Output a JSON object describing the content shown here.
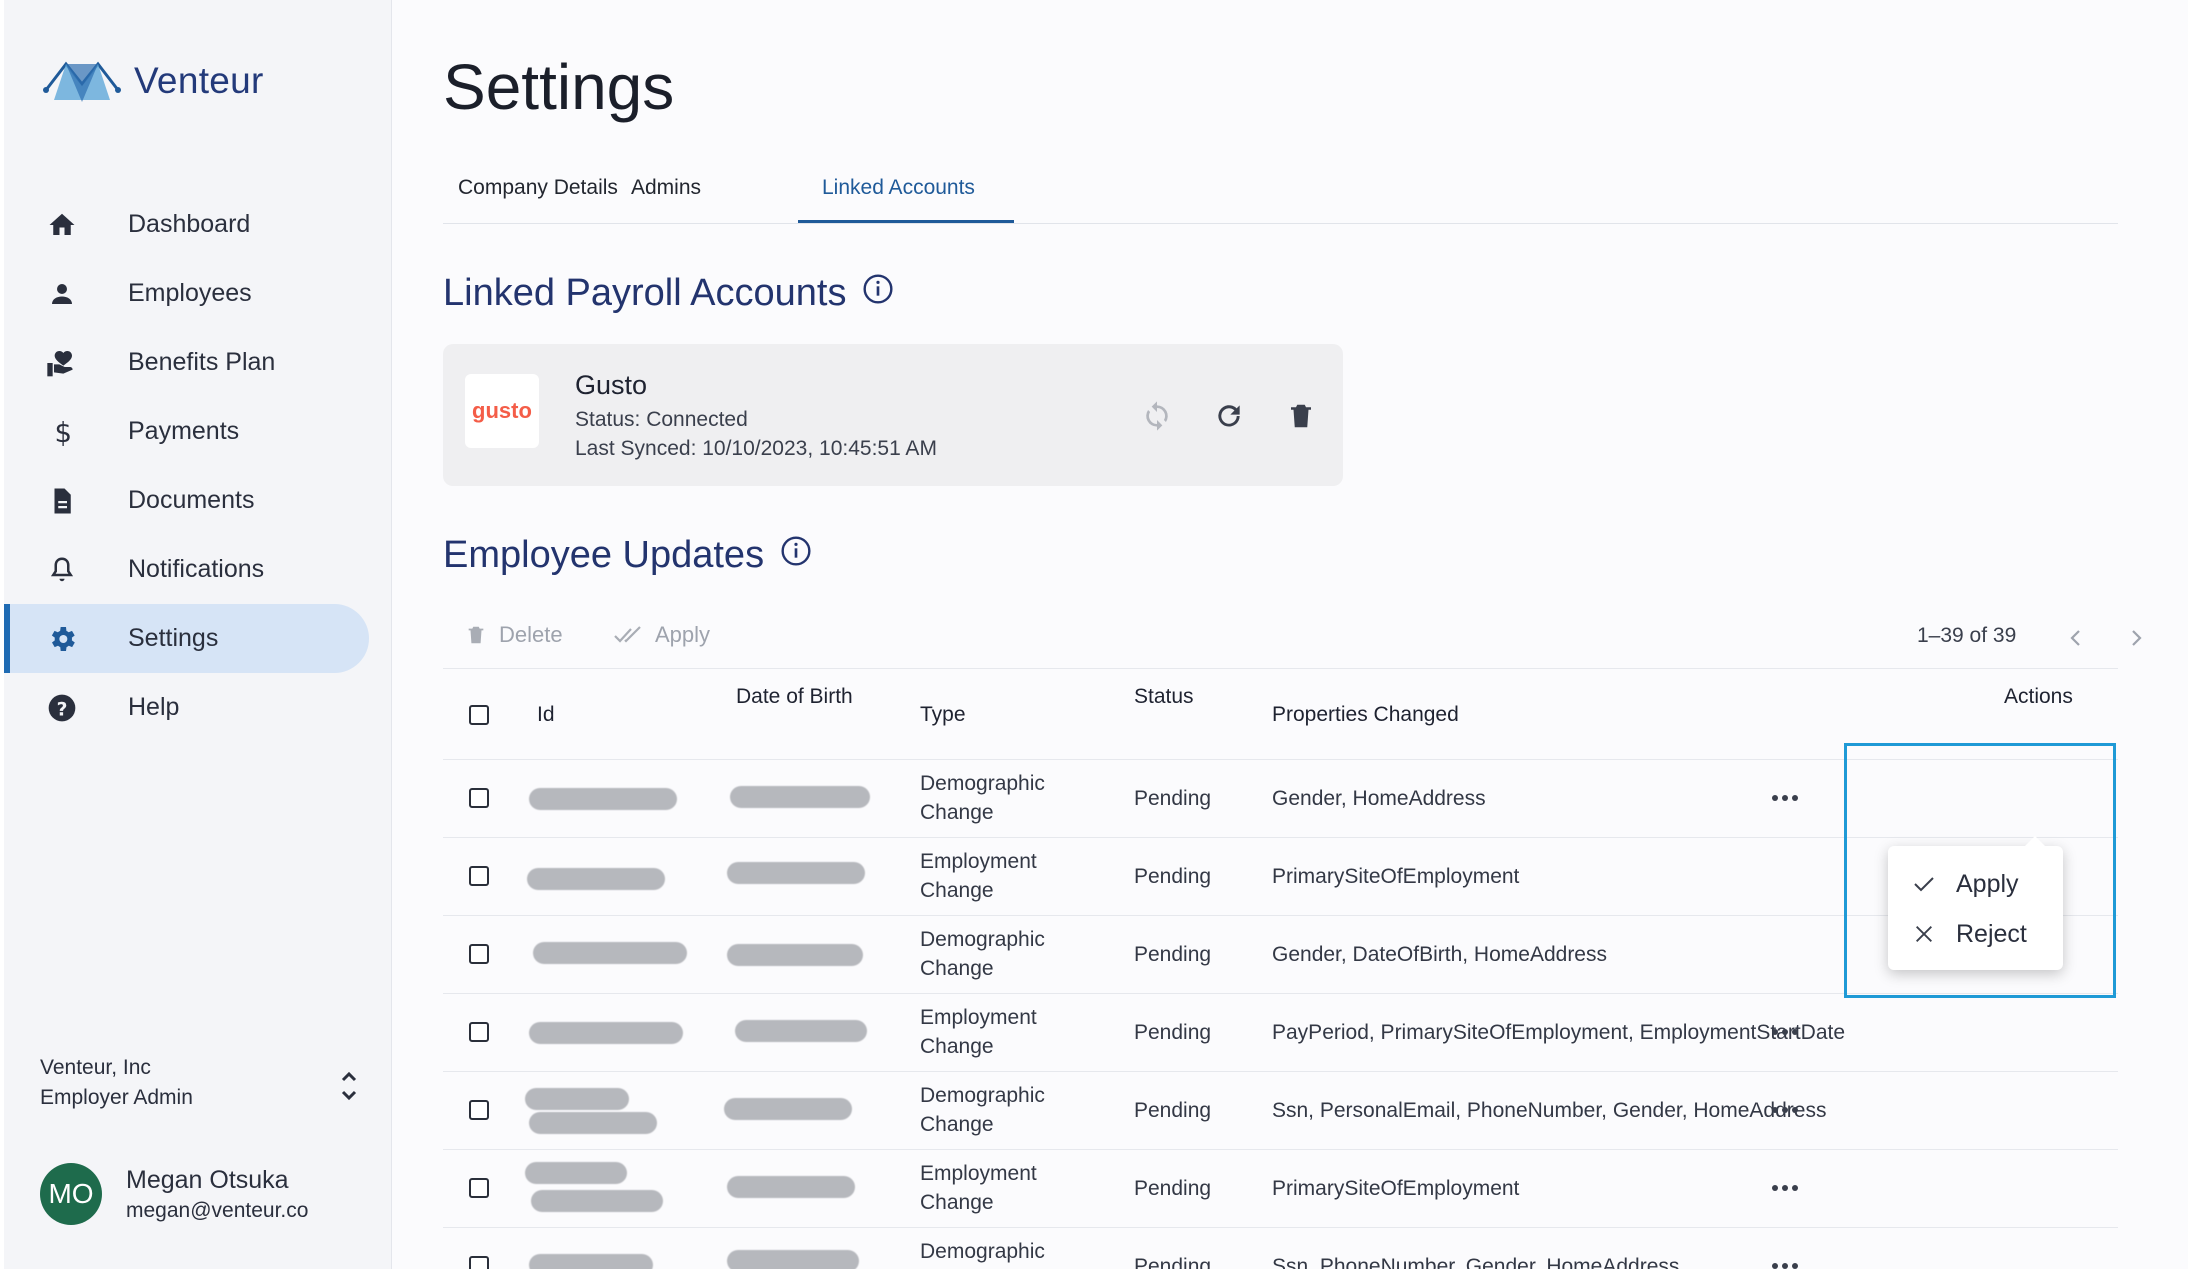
{
  "app": {
    "name": "Venteur"
  },
  "sidebar": {
    "items": [
      {
        "label": "Dashboard",
        "icon": "home-icon"
      },
      {
        "label": "Employees",
        "icon": "person-icon"
      },
      {
        "label": "Benefits Plan",
        "icon": "heart-hand-icon"
      },
      {
        "label": "Payments",
        "icon": "dollar-icon"
      },
      {
        "label": "Documents",
        "icon": "document-icon"
      },
      {
        "label": "Notifications",
        "icon": "bell-icon"
      },
      {
        "label": "Settings",
        "icon": "gear-icon",
        "active": true
      },
      {
        "label": "Help",
        "icon": "help-icon"
      }
    ],
    "company": {
      "name": "Venteur, Inc",
      "role": "Employer Admin"
    },
    "user": {
      "initials": "MO",
      "name": "Megan Otsuka",
      "email": "megan@venteur.co"
    }
  },
  "page": {
    "title": "Settings"
  },
  "tabs": [
    {
      "label": "Company Details"
    },
    {
      "label": "Admins"
    },
    {
      "label": "Linked Accounts",
      "active": true
    }
  ],
  "linked_payroll": {
    "title": "Linked Payroll Accounts",
    "account": {
      "logo_text": "gusto",
      "name": "Gusto",
      "status": "Status: Connected",
      "last_synced": "Last Synced: 10/10/2023, 10:45:51 AM"
    }
  },
  "employee_updates": {
    "title": "Employee Updates",
    "toolbar": {
      "delete_label": "Delete",
      "apply_label": "Apply",
      "pagination": "1–39 of 39"
    },
    "columns": {
      "id": "Id",
      "dob": "Date of Birth",
      "type": "Type",
      "status": "Status",
      "properties": "Properties Changed",
      "actions": "Actions"
    },
    "rows": [
      {
        "type": "Demographic Change",
        "status": "Pending",
        "properties": "Gender, HomeAddress"
      },
      {
        "type": "Employment Change",
        "status": "Pending",
        "properties": "PrimarySiteOfEmployment"
      },
      {
        "type": "Demographic Change",
        "status": "Pending",
        "properties": "Gender, DateOfBirth, HomeAddress"
      },
      {
        "type": "Employment Change",
        "status": "Pending",
        "properties": "PayPeriod, PrimarySiteOfEmployment, EmploymentStartDate"
      },
      {
        "type": "Demographic Change",
        "status": "Pending",
        "properties": "Ssn, PersonalEmail, PhoneNumber, Gender, HomeAddress"
      },
      {
        "type": "Employment Change",
        "status": "Pending",
        "properties": "PrimarySiteOfEmployment"
      },
      {
        "type": "Demographic Change",
        "status": "Pending",
        "properties": "Ssn, PhoneNumber, Gender, HomeAddress"
      }
    ],
    "row_menu": {
      "apply_label": "Apply",
      "reject_label": "Reject"
    }
  },
  "colors": {
    "accent": "#1f5a99",
    "title": "#23346e",
    "active_nav": "#d6e4f6",
    "highlight": "#1f9ad6",
    "avatar": "#1e6b4c"
  }
}
